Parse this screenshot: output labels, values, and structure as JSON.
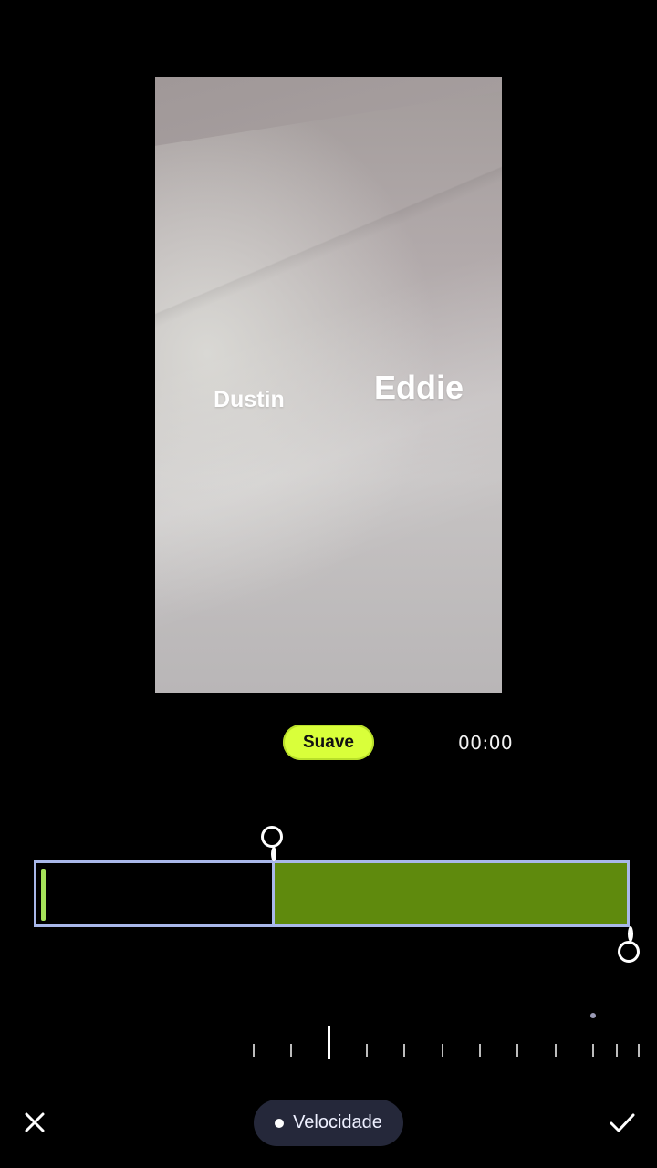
{
  "preview": {
    "labels": [
      {
        "text": "Dustin"
      },
      {
        "text": "Eddie"
      }
    ]
  },
  "controls": {
    "mode_label": "Suave",
    "timestamp": "00:00"
  },
  "timeline": {
    "filled_fraction_start": 0.4,
    "playhead_fraction": 0.0
  },
  "bottom_bar": {
    "close_icon": "close-icon",
    "speed_label": "Velocidade",
    "confirm_icon": "check-icon"
  },
  "colors": {
    "accent": "#d9ff3a",
    "track_fill": "#5f8a0d",
    "track_border": "#a9b8ea",
    "pill_bg": "#25283a"
  }
}
